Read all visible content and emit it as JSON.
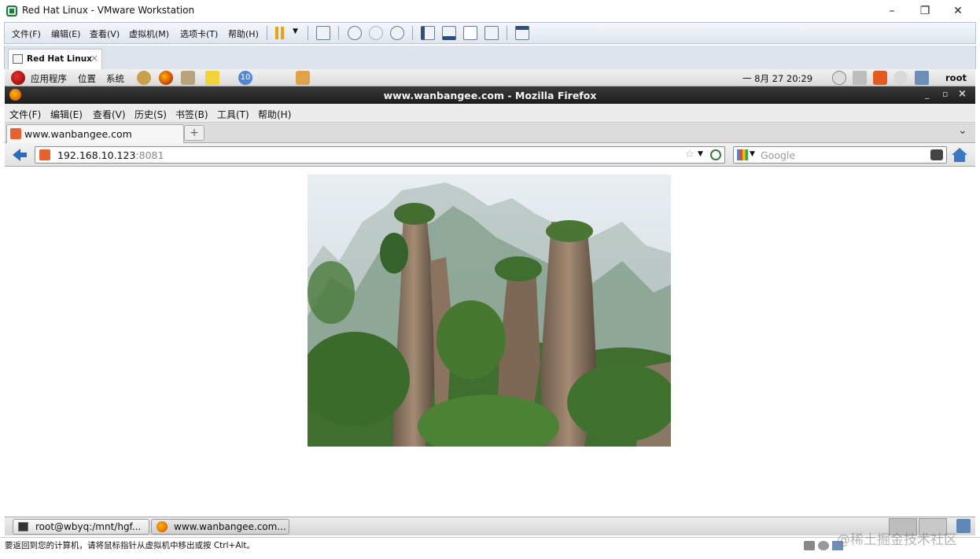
{
  "vmware": {
    "window_title": "Red Hat Linux - VMware Workstation",
    "menu": [
      "文件(F)",
      "编辑(E)",
      "查看(V)",
      "虚拟机(M)",
      "选项卡(T)",
      "帮助(H)"
    ],
    "tab_label": "Red Hat Linux",
    "tab_close": "×",
    "status_text": "要返回到您的计算机，请将鼠标指针从虚拟机中移出或按 Ctrl+Alt。",
    "watermark": "@稀土掘金技术社区"
  },
  "gnome_panel": {
    "menus": [
      "应用程序",
      "位置",
      "系统"
    ],
    "badge": "10",
    "clock": "一 8月 27 20:29",
    "user": "root"
  },
  "firefox": {
    "window_title": "www.wanbangee.com - Mozilla Firefox",
    "title_buttons": [
      "_",
      "▫",
      "×"
    ],
    "menu": [
      "文件(F)",
      "编辑(E)",
      "查看(V)",
      "历史(S)",
      "书签(B)",
      "工具(T)",
      "帮助(H)"
    ],
    "tab_title": "www.wanbangee.com",
    "new_tab": "+",
    "tab_list": "⌄",
    "url_host": "192.168.10.123",
    "url_port": ":8081",
    "search_placeholder": "Google"
  },
  "taskbar": {
    "items": [
      "root@wbyq:/mnt/hgf...",
      "www.wanbangee.com..."
    ]
  },
  "colors": {
    "ff_title_bg": "#1c1c1c",
    "vm_menu_bg": "#dfe6f0",
    "back_arrow": "#2a6bbf"
  }
}
